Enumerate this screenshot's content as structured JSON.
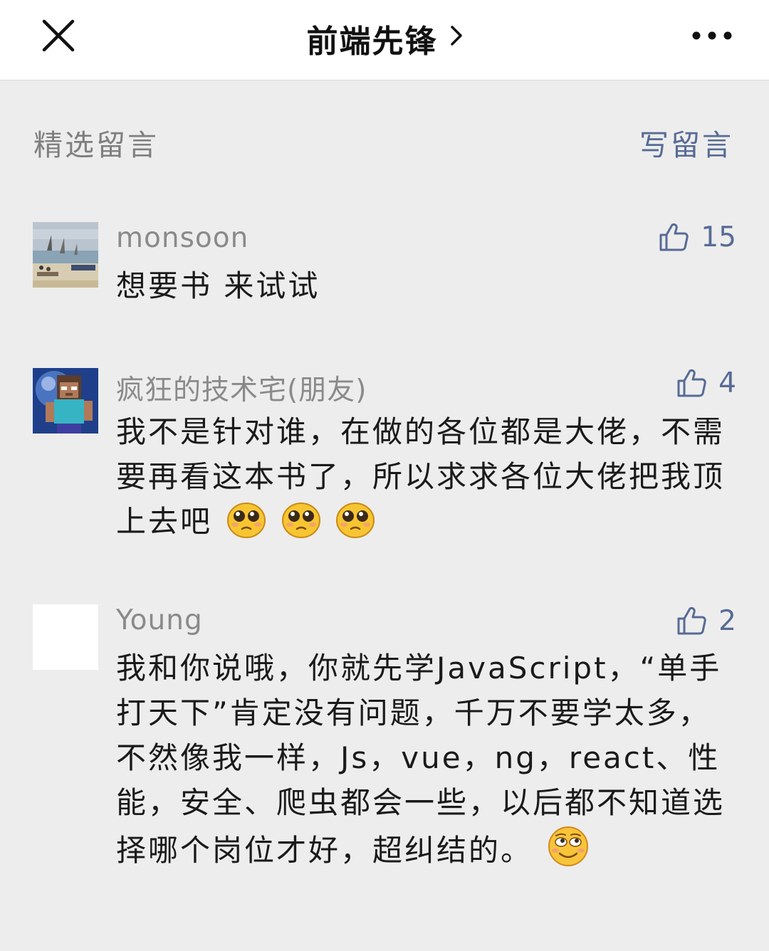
{
  "nav": {
    "title": "前端先锋",
    "close_icon": "close-icon",
    "chevron_icon": "chevron-right-icon",
    "more_icon": "more-dots-icon"
  },
  "section": {
    "title": "精选留言",
    "write_label": "写留言"
  },
  "colors": {
    "link": "#576b95",
    "background": "#ededed",
    "muted": "#8a8a8a"
  },
  "comments": [
    {
      "author": "monsoon",
      "avatar_icon": "seaside-painting-avatar",
      "likes": "15",
      "text": "想要书 来试试",
      "emojis": []
    },
    {
      "author": "疯狂的技术宅(朋友)",
      "avatar_icon": "minecraft-character-avatar",
      "likes": "4",
      "text": "我不是针对谁，在做的各位都是大佬，不需要再看这本书了，所以求求各位大佬把我顶上去吧",
      "emojis": [
        "pleading-face-emoji",
        "pleading-face-emoji",
        "pleading-face-emoji"
      ]
    },
    {
      "author": "Young",
      "avatar_icon": "blank-white-avatar",
      "likes": "2",
      "text": "我和你说哦，你就先学JavaScript，“单手打天下”肯定没有问题，千万不要学太多，不然像我一样，Js，vue，ng，react、性能，安全、爬虫都会一些，以后都不知道选择哪个岗位才好，超纠结的。",
      "emojis": [
        "awkward-smile-emoji"
      ]
    }
  ]
}
